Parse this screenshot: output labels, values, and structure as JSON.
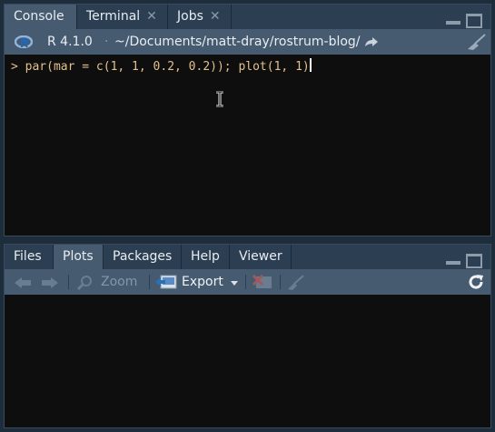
{
  "colors": {
    "tab_bar": "#2c3e51",
    "toolbar": "#465b70",
    "pane_body": "#0e0e0e",
    "code_text": "#e3c08a"
  },
  "console_pane": {
    "tabs": [
      {
        "label": "Console",
        "active": true
      },
      {
        "label": "Terminal",
        "closable": true
      },
      {
        "label": "Jobs",
        "closable": true
      }
    ],
    "toolbar": {
      "r_version": "R 4.1.0",
      "separator": "·",
      "working_dir": "~/Documents/matt-dray/rostrum-blog/"
    },
    "prompt": ">",
    "command": "par(mar = c(1, 1, 0.2, 0.2)); plot(1, 1)"
  },
  "viewer_pane": {
    "tabs": [
      {
        "label": "Files"
      },
      {
        "label": "Plots",
        "active": true
      },
      {
        "label": "Packages"
      },
      {
        "label": "Help"
      },
      {
        "label": "Viewer"
      }
    ],
    "toolbar": {
      "zoom_label": "Zoom",
      "export_label": "Export"
    }
  }
}
